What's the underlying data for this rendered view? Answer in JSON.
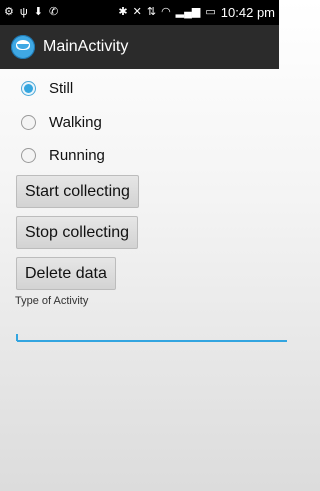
{
  "status_bar": {
    "time": "10:42 pm",
    "left_icons": [
      "notification-icon",
      "usb-icon",
      "download-icon",
      "phone-icon"
    ],
    "right_icons": [
      "bluetooth-icon",
      "mute-icon",
      "data-icon",
      "wifi-icon",
      "signal-icon",
      "battery-icon"
    ]
  },
  "action_bar": {
    "title": "MainActivity"
  },
  "activity_options": [
    {
      "label": "Still",
      "checked": true
    },
    {
      "label": "Walking",
      "checked": false
    },
    {
      "label": "Running",
      "checked": false
    }
  ],
  "buttons": {
    "start": "Start collecting",
    "stop": "Stop collecting",
    "delete": "Delete data"
  },
  "input": {
    "label": "Type of Activity",
    "value": ""
  },
  "colors": {
    "accent": "#33a5e0",
    "action_bar": "#2b2b2b",
    "status_bar": "#000000"
  }
}
